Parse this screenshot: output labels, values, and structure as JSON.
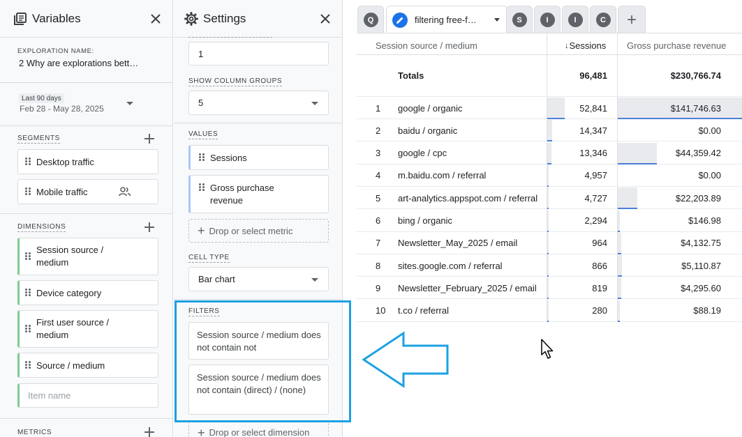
{
  "variables": {
    "title": "Variables",
    "exploration_label": "EXPLORATION NAME:",
    "exploration_name": "2 Why are explorations bett…",
    "date_preset": "Last 90 days",
    "date_range": "Feb 28 - May 28, 2025",
    "segments_label": "SEGMENTS",
    "segments": [
      "Desktop traffic",
      "Mobile traffic"
    ],
    "dimensions_label": "DIMENSIONS",
    "dimensions": [
      "Session source / medium",
      "Device category",
      "First user source / medium",
      "Source / medium"
    ],
    "item_placeholder": "Item name",
    "metrics_label": "METRICS"
  },
  "settings": {
    "title": "Settings",
    "start_row": "1",
    "column_groups_label": "SHOW COLUMN GROUPS",
    "column_groups_value": "5",
    "values_label": "VALUES",
    "values": [
      "Sessions",
      "Gross purchase revenue"
    ],
    "drop_metric": "Drop or select metric",
    "cell_type_label": "CELL TYPE",
    "cell_type_value": "Bar chart",
    "filters_label": "FILTERS",
    "filters": [
      "Session source / medium does not contain not",
      "Session source / medium does not contain (direct) / (none)"
    ],
    "drop_dimension": "Drop or select dimension"
  },
  "tabs": {
    "letters": [
      "Q",
      "S",
      "I",
      "I",
      "C"
    ],
    "active_label": "filtering free-f…",
    "add": "+"
  },
  "table": {
    "headers": [
      "Session source / medium",
      "Sessions",
      "Gross purchase revenue"
    ],
    "totals_label": "Totals",
    "totals": [
      "96,481",
      "$230,766.74"
    ],
    "rows": [
      {
        "idx": "1",
        "source": "google / organic",
        "sessions": "52,841",
        "revenue": "$141,746.63",
        "s": 52841,
        "r": 141746.63
      },
      {
        "idx": "2",
        "source": "baidu / organic",
        "sessions": "14,347",
        "revenue": "$0.00",
        "s": 14347,
        "r": 0
      },
      {
        "idx": "3",
        "source": "google / cpc",
        "sessions": "13,346",
        "revenue": "$44,359.42",
        "s": 13346,
        "r": 44359.42
      },
      {
        "idx": "4",
        "source": "m.baidu.com / referral",
        "sessions": "4,957",
        "revenue": "$0.00",
        "s": 4957,
        "r": 0
      },
      {
        "idx": "5",
        "source": "art-analytics.appspot.com / referral",
        "sessions": "4,727",
        "revenue": "$22,203.89",
        "s": 4727,
        "r": 22203.89
      },
      {
        "idx": "6",
        "source": "bing / organic",
        "sessions": "2,294",
        "revenue": "$146.98",
        "s": 2294,
        "r": 146.98
      },
      {
        "idx": "7",
        "source": "Newsletter_May_2025 / email",
        "sessions": "964",
        "revenue": "$4,132.75",
        "s": 964,
        "r": 4132.75
      },
      {
        "idx": "8",
        "source": "sites.google.com / referral",
        "sessions": "866",
        "revenue": "$5,110.87",
        "s": 866,
        "r": 5110.87
      },
      {
        "idx": "9",
        "source": "Newsletter_February_2025 / email",
        "sessions": "819",
        "revenue": "$4,295.60",
        "s": 819,
        "r": 4295.6
      },
      {
        "idx": "10",
        "source": "t.co / referral",
        "sessions": "280",
        "revenue": "$88.19",
        "s": 280,
        "r": 88.19
      }
    ]
  },
  "colors": {
    "accent_blue": "#4a7fd8",
    "highlight_box": "#1ba1e2",
    "dimension_green": "#81c995",
    "metric_blue": "#a8c7fa",
    "bar_fill": "#e8eaed"
  }
}
